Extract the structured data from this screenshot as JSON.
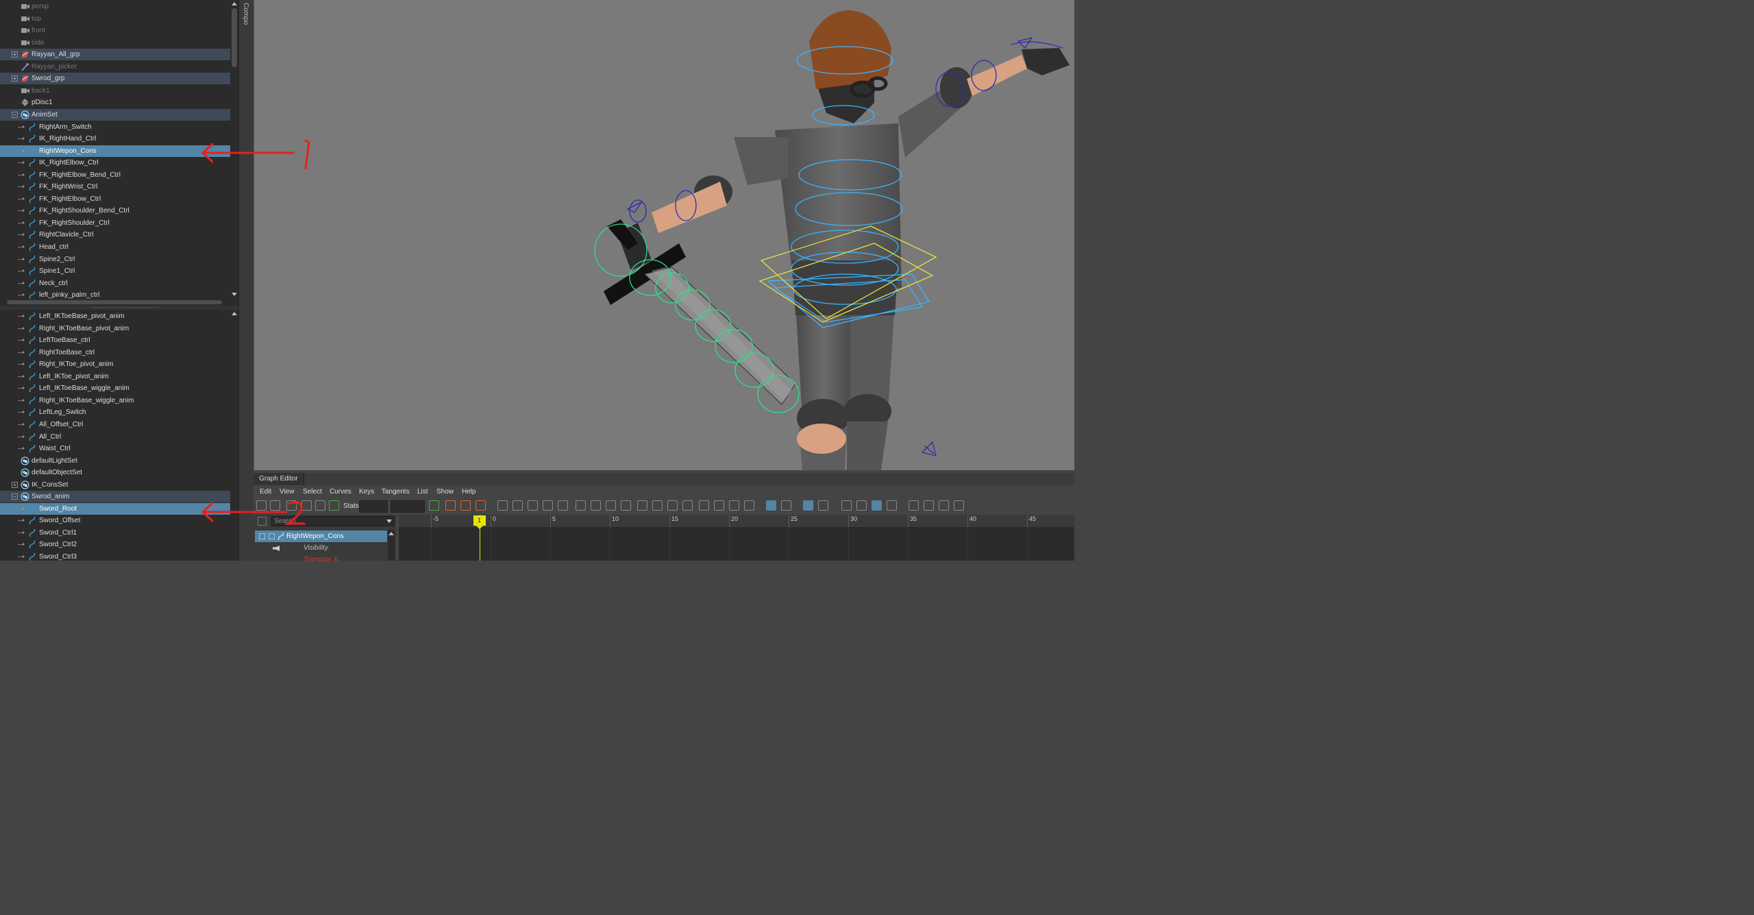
{
  "outliner": {
    "top_items": [
      {
        "label": "persp",
        "dim": true,
        "icon": "camera-icon"
      },
      {
        "label": "top",
        "dim": true,
        "icon": "camera-icon"
      },
      {
        "label": "front",
        "dim": true,
        "icon": "camera-icon"
      },
      {
        "label": "side",
        "dim": true,
        "icon": "camera-icon"
      },
      {
        "label": "Rayyan_All_grp",
        "dim": false,
        "icon": "group-icon",
        "expand": "+",
        "group": true
      },
      {
        "label": "Rayyan_picker",
        "dim": true,
        "icon": "picker-icon"
      },
      {
        "label": "Swrod_grp",
        "dim": false,
        "icon": "group-icon",
        "expand": "+",
        "group": true
      },
      {
        "label": "back1",
        "dim": true,
        "icon": "camera-icon"
      },
      {
        "label": "pDisc1",
        "dim": false,
        "icon": "mesh-icon"
      },
      {
        "label": "AnimSet",
        "dim": false,
        "icon": "set-icon",
        "expand": "−",
        "group": true
      },
      {
        "label": "RightArm_Switch",
        "child": true
      },
      {
        "label": "IK_RightHand_Ctrl",
        "child": true
      },
      {
        "label": "RightWepon_Cons",
        "child": true,
        "selected": true
      },
      {
        "label": "IK_RightElbow_Ctrl",
        "child": true
      },
      {
        "label": "FK_RightElbow_Bend_Ctrl",
        "child": true
      },
      {
        "label": "FK_RightWrist_Ctrl",
        "child": true
      },
      {
        "label": "FK_RightElbow_Ctrl",
        "child": true
      },
      {
        "label": "FK_RightShoulder_Bend_Ctrl",
        "child": true
      },
      {
        "label": "FK_RightShoulder_Ctrl",
        "child": true
      },
      {
        "label": "RightClavicle_Ctrl",
        "child": true
      },
      {
        "label": "Head_ctrl",
        "child": true
      },
      {
        "label": "Spine2_Ctrl",
        "child": true
      },
      {
        "label": "Spine1_Ctrl",
        "child": true
      },
      {
        "label": "Neck_ctrl",
        "child": true
      },
      {
        "label": "left_pinky_palm_ctrl",
        "child": true
      }
    ],
    "bottom_items": [
      {
        "label": "Left_IKToeBase_pivot_anim",
        "child": true
      },
      {
        "label": "Right_IKToeBase_pivot_anim",
        "child": true
      },
      {
        "label": "LeftToeBase_ctrl",
        "child": true
      },
      {
        "label": "RightToeBase_ctrl",
        "child": true
      },
      {
        "label": "Right_IKToe_pivot_anim",
        "child": true
      },
      {
        "label": "Left_IKToe_pivot_anim",
        "child": true
      },
      {
        "label": "Left_IKToeBase_wiggle_anim",
        "child": true
      },
      {
        "label": "Right_IKToeBase_wiggle_anim",
        "child": true
      },
      {
        "label": "LeftLeg_Switch",
        "child": true
      },
      {
        "label": "All_Offset_Ctrl",
        "child": true
      },
      {
        "label": "All_Ctrl",
        "child": true
      },
      {
        "label": "Waist_Ctrl",
        "child": true
      },
      {
        "label": "defaultLightSet",
        "icon": "set-icon"
      },
      {
        "label": "defaultObjectSet",
        "icon": "set-icon"
      },
      {
        "label": "IK_ConsSet",
        "icon": "set-icon",
        "expand": "+"
      },
      {
        "label": "Swrod_anim",
        "icon": "set-icon",
        "expand": "−",
        "group": true
      },
      {
        "label": "Sword_Root",
        "child": true,
        "selected": true
      },
      {
        "label": "Sword_Offset",
        "child": true
      },
      {
        "label": "Sword_Ctrl1",
        "child": true
      },
      {
        "label": "Sword_Ctrl2",
        "child": true
      },
      {
        "label": "Sword_Ctrl3",
        "child": true
      }
    ]
  },
  "side_panel": {
    "label": "Compo"
  },
  "graph_editor": {
    "title": "Graph Editor",
    "menu": [
      "Edit",
      "View",
      "Select",
      "Curves",
      "Keys",
      "Tangents",
      "List",
      "Show",
      "Help"
    ],
    "stats_label": "Stats",
    "search_placeholder": "Search",
    "selected_node": "RightWepon_Cons",
    "channels": [
      "Visibility",
      "Translate X"
    ],
    "ruler": {
      "ticks": [
        -5,
        0,
        5,
        10,
        15,
        20,
        25,
        30,
        35,
        40,
        45
      ],
      "current_frame": 1
    }
  },
  "annotations": {
    "marker1": "1",
    "marker2": "2",
    "color": "#e8201c"
  },
  "colors": {
    "selection": "#5285a6",
    "group_row": "#3f4a58",
    "outliner_bg": "#2b2b2b",
    "viewport_bg": "#7a7a7a",
    "current_frame": "#e6e600"
  }
}
